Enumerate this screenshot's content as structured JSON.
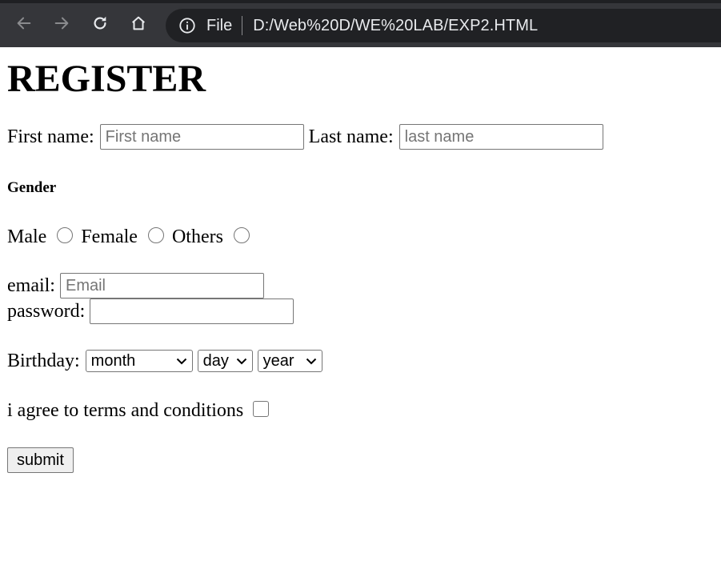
{
  "browser": {
    "back_icon": "arrow-left-icon",
    "forward_icon": "arrow-right-icon",
    "reload_icon": "reload-icon",
    "home_icon": "home-icon",
    "info_icon": "info-icon",
    "scheme_chip": "File",
    "url": "D:/Web%20D/WE%20LAB/EXP2.HTML",
    "colors": {
      "toolbar": "#35363a",
      "omnibox": "#202124",
      "text": "#e8eaed"
    }
  },
  "form": {
    "title": "REGISTER",
    "first_name_label": "First name:",
    "first_name_placeholder": "First name",
    "last_name_label": "Last name:",
    "last_name_placeholder": "last name",
    "gender_heading": "Gender",
    "gender_options": [
      "Male",
      "Female",
      "Others"
    ],
    "email_label": "email:",
    "email_placeholder": "Email",
    "password_label": "password:",
    "password_value": "",
    "birthday_label": "Birthday:",
    "birthday_selects": {
      "month": "month",
      "day": "day",
      "year": "year"
    },
    "terms_label": "i agree to terms and conditions",
    "submit_label": "submit"
  }
}
